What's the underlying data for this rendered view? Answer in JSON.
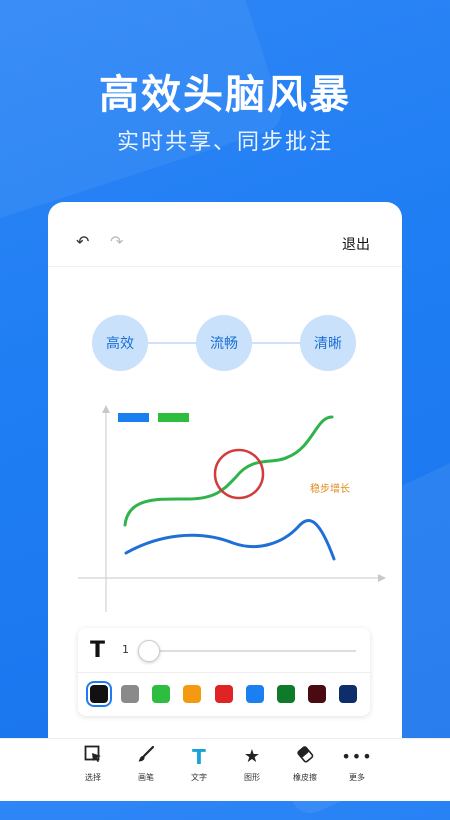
{
  "hero": {
    "title": "高效头脑风暴",
    "subtitle": "实时共享、同步批注"
  },
  "toolbar": {
    "exit_label": "退出"
  },
  "canvas": {
    "bubbles": [
      "高效",
      "流畅",
      "清晰"
    ],
    "annotation": "稳步增长",
    "colors": {
      "line_green": "#2fb34a",
      "line_blue": "#1f6fd6",
      "circle_red": "#d23b3b",
      "annotation": "#e08a1b"
    }
  },
  "text_panel": {
    "size_value": "1"
  },
  "palette": [
    "#111111",
    "#8a8a8a",
    "#2dbe3f",
    "#f59a10",
    "#e02424",
    "#1a7ff0",
    "#0f7a2a",
    "#4a0a12",
    "#0e2d6b"
  ],
  "tools": [
    {
      "label": "选择",
      "icon": "select-icon"
    },
    {
      "label": "画笔",
      "icon": "brush-icon"
    },
    {
      "label": "文字",
      "icon": "text-icon"
    },
    {
      "label": "图形",
      "icon": "star-icon"
    },
    {
      "label": "橡皮擦",
      "icon": "eraser-icon"
    },
    {
      "label": "更多",
      "icon": "more-icon"
    }
  ]
}
